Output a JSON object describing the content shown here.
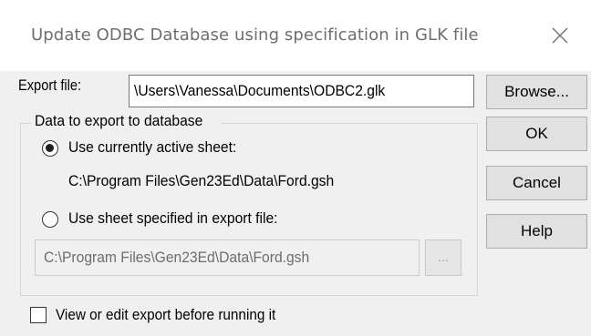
{
  "dialog": {
    "title": "Update ODBC Database using specification in GLK file",
    "close_icon": "close-icon"
  },
  "export_file": {
    "label": "Export file:",
    "value": "\\Users\\Vanessa\\Documents\\ODBC2.glk"
  },
  "buttons": {
    "browse": "Browse...",
    "ok": "OK",
    "cancel": "Cancel",
    "help": "Help",
    "ellipsis": "..."
  },
  "group": {
    "title": "Data to export to database",
    "option_active": {
      "label": "Use currently active sheet:",
      "selected": true,
      "path": "C:\\Program Files\\Gen23Ed\\Data\\Ford.gsh"
    },
    "option_specified": {
      "label": "Use sheet specified in export file:",
      "selected": false,
      "path": "C:\\Program Files\\Gen23Ed\\Data\\Ford.gsh"
    }
  },
  "view_edit_checkbox": {
    "label": "View or edit export before running it",
    "checked": false
  }
}
